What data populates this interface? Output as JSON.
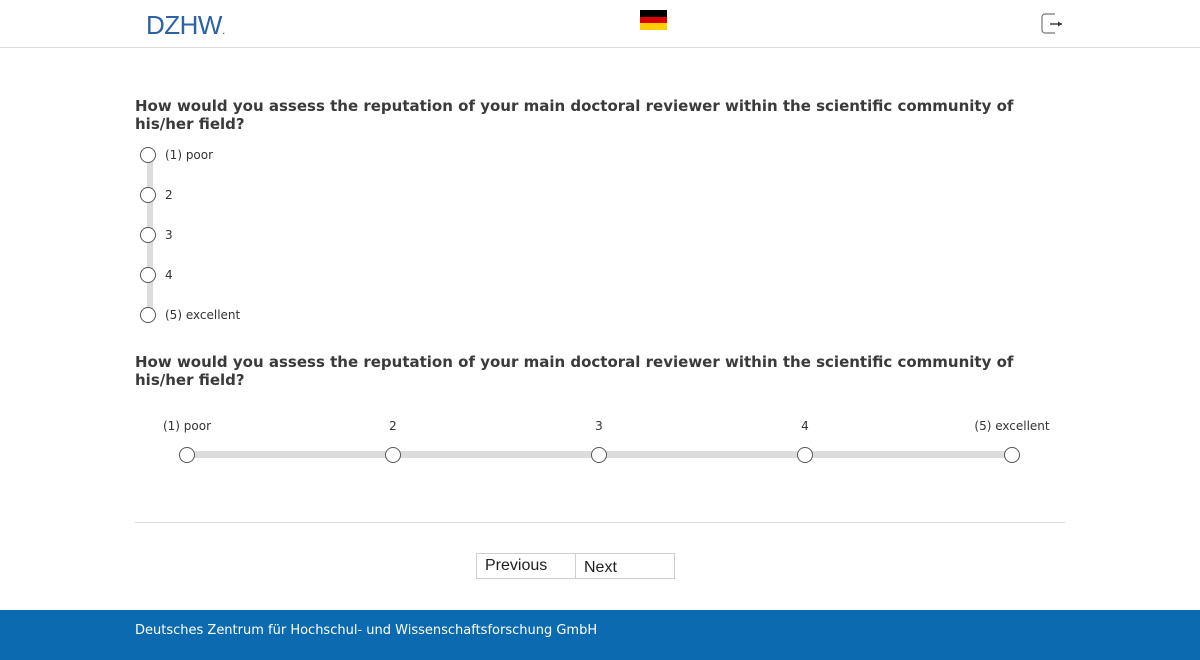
{
  "header": {
    "logo_text": "DZHW",
    "logo_dot": ".",
    "language_flag": "germany-flag-icon",
    "logout_icon": "logout-icon"
  },
  "questions": [
    {
      "text": "How would you assess the reputation of your main doctoral reviewer within the scientific community of his/her field?",
      "layout": "vertical",
      "options": [
        "(1) poor",
        "2",
        "3",
        "4",
        "(5) excellent"
      ]
    },
    {
      "text": "How would you assess the reputation of your main doctoral reviewer within the scientific community of his/her field?",
      "layout": "horizontal",
      "options": [
        "(1) poor",
        "2",
        "3",
        "4",
        "(5) excellent"
      ]
    }
  ],
  "nav": {
    "previous_label": "Previous",
    "next_label": "Next"
  },
  "footer": {
    "text": "Deutsches Zentrum für Hochschul- und Wissenschaftsforschung GmbH"
  },
  "colors": {
    "brand_blue": "#2b63a6",
    "footer_blue": "#0b6ab0",
    "track_gray": "#dcdcdc"
  }
}
